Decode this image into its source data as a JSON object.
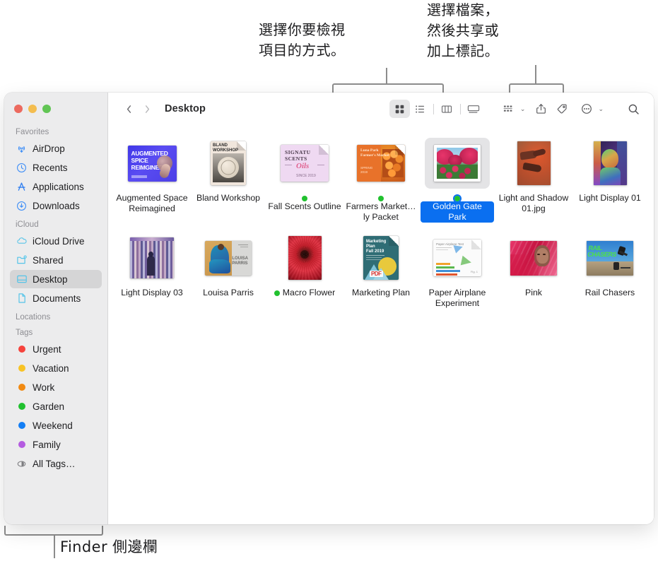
{
  "annotations": {
    "view_modes": "選擇你要檢視\n項目的方式。",
    "share_tag": "選擇檔案，\n然後共享或\n加上標記。",
    "sidebar": "Finder 側邊欄"
  },
  "window": {
    "traffic_lights": [
      "close-red",
      "minimize-yellow",
      "zoom-green"
    ]
  },
  "sidebar": {
    "sections": [
      {
        "title": "Favorites",
        "items": [
          {
            "label": "AirDrop",
            "icon": "airdrop-icon",
            "selected": false
          },
          {
            "label": "Recents",
            "icon": "clock-icon",
            "selected": false
          },
          {
            "label": "Applications",
            "icon": "applications-icon",
            "selected": false
          },
          {
            "label": "Downloads",
            "icon": "downloads-icon",
            "selected": false
          }
        ]
      },
      {
        "title": "iCloud",
        "items": [
          {
            "label": "iCloud Drive",
            "icon": "cloud-icon",
            "selected": false
          },
          {
            "label": "Shared",
            "icon": "shared-folder-icon",
            "selected": false
          },
          {
            "label": "Desktop",
            "icon": "desktop-icon",
            "selected": true
          },
          {
            "label": "Documents",
            "icon": "document-icon",
            "selected": false
          }
        ]
      },
      {
        "title": "Locations",
        "items": []
      },
      {
        "title": "Tags",
        "items": [
          {
            "label": "Urgent",
            "icon": "tag-dot-icon",
            "color": "#f6433c",
            "selected": false
          },
          {
            "label": "Vacation",
            "icon": "tag-dot-icon",
            "color": "#f8c325",
            "selected": false
          },
          {
            "label": "Work",
            "icon": "tag-dot-icon",
            "color": "#f18a12",
            "selected": false
          },
          {
            "label": "Garden",
            "icon": "tag-dot-icon",
            "color": "#21c12f",
            "selected": false
          },
          {
            "label": "Weekend",
            "icon": "tag-dot-icon",
            "color": "#137ef5",
            "selected": false
          },
          {
            "label": "Family",
            "icon": "tag-dot-icon",
            "color": "#b45ce0",
            "selected": false
          },
          {
            "label": "All Tags…",
            "icon": "all-tags-icon",
            "color": "",
            "selected": false
          }
        ]
      }
    ]
  },
  "toolbar": {
    "back_label": "‹",
    "forward_label": "›",
    "path_title": "Desktop",
    "view_modes": [
      {
        "name": "icon-view",
        "active": true
      },
      {
        "name": "list-view",
        "active": false
      },
      {
        "name": "column-view",
        "active": false
      },
      {
        "name": "gallery-view",
        "active": false
      }
    ],
    "group_by": "group-by-icon",
    "share": "share-icon",
    "tag": "tag-icon",
    "more": "more-actions-icon",
    "search": "search-icon",
    "chevron": "⌄"
  },
  "files": [
    {
      "name": "Augmented Space Reimagined",
      "kind": "image",
      "tag": "",
      "selected": false,
      "thumb": "poster-blue"
    },
    {
      "name": "Bland Workshop",
      "kind": "document",
      "tag": "",
      "selected": false,
      "thumb": "doc-bland"
    },
    {
      "name": "Fall Scents Outline",
      "kind": "document",
      "tag": "#21c12f",
      "selected": false,
      "thumb": "doc-scents"
    },
    {
      "name": "Farmers Market…ly Packet",
      "kind": "document",
      "tag": "#21c12f",
      "selected": false,
      "thumb": "doc-farmers"
    },
    {
      "name": "Golden Gate Park",
      "kind": "image",
      "tag": "#21c12f",
      "selected": true,
      "thumb": "photo-flowers"
    },
    {
      "name": "Light and Shadow 01.jpg",
      "kind": "image",
      "tag": "",
      "selected": false,
      "thumb": "photo-hands"
    },
    {
      "name": "Light Display 01",
      "kind": "image",
      "tag": "",
      "selected": false,
      "thumb": "photo-portrait"
    },
    {
      "name": "Light Display 03",
      "kind": "image",
      "tag": "",
      "selected": false,
      "thumb": "photo-stripes"
    },
    {
      "name": "Louisa Parris",
      "kind": "image",
      "tag": "",
      "selected": false,
      "thumb": "photo-dancer"
    },
    {
      "name": "Macro Flower",
      "kind": "image",
      "tag": "#21c12f",
      "selected": false,
      "thumb": "photo-macro"
    },
    {
      "name": "Marketing Plan",
      "kind": "pdf",
      "tag": "",
      "selected": false,
      "thumb": "doc-marketing"
    },
    {
      "name": "Paper Airplane Experiment",
      "kind": "document",
      "tag": "",
      "selected": false,
      "thumb": "doc-airplane"
    },
    {
      "name": "Pink",
      "kind": "image",
      "tag": "",
      "selected": false,
      "thumb": "photo-pink"
    },
    {
      "name": "Rail Chasers",
      "kind": "image",
      "tag": "",
      "selected": false,
      "thumb": "photo-rail"
    }
  ],
  "colors": {
    "selection_blue": "#0a6ff0",
    "sidebar_bg": "#ececed",
    "callout_line": "#8c8c8c"
  }
}
